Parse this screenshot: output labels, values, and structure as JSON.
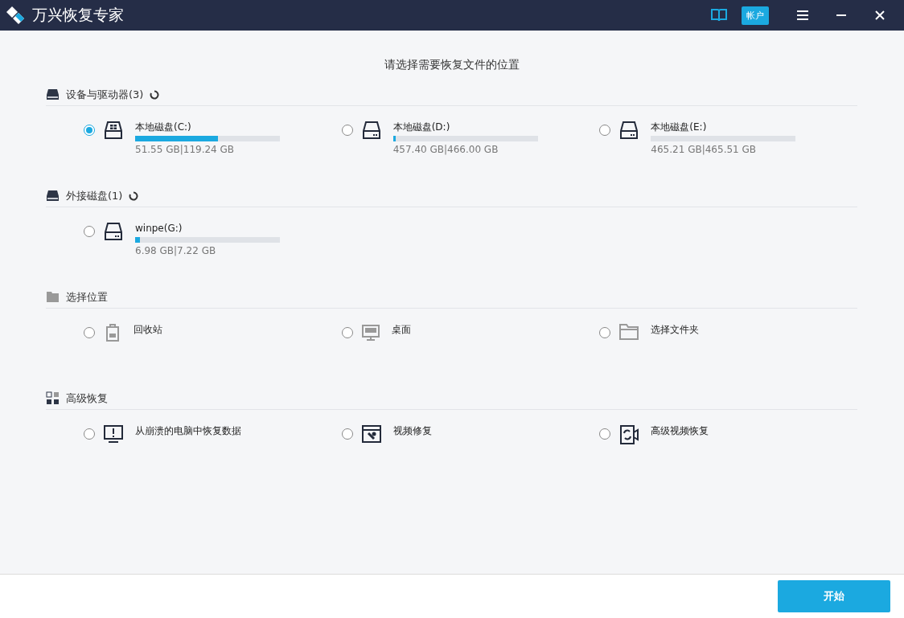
{
  "window": {
    "title": "万兴恢复专家",
    "account_button": "帐户"
  },
  "heading": "请选择需要恢复文件的位置",
  "sections": [
    {
      "kind": "drives",
      "title": "设备与驱动器(3)",
      "loading": true,
      "items": [
        {
          "kind": "system",
          "label": "本地磁盘(C:)",
          "selected": true,
          "level": 0.57,
          "reading": "51.55 GB|119.24 GB"
        },
        {
          "kind": "drive",
          "label": "本地磁盘(D:)",
          "selected": false,
          "level": 0.02,
          "reading": "457.40 GB|466.00 GB"
        },
        {
          "kind": "drive",
          "label": "本地磁盘(E:)",
          "selected": false,
          "level": 0,
          "reading": "465.21 GB|465.51 GB"
        }
      ]
    },
    {
      "kind": "drives",
      "title": "外接磁盘(1)",
      "loading": true,
      "items": [
        {
          "kind": "drive",
          "label": "winpe(G:)",
          "selected": false,
          "level": 0.035,
          "reading": "6.98 GB|7.22 GB"
        }
      ]
    },
    {
      "kind": "location",
      "title": "选择位置",
      "loading": false,
      "items": [
        {
          "kind": "trash",
          "label": "回收站",
          "selected": false
        },
        {
          "kind": "desktop",
          "label": "桌面",
          "selected": false
        },
        {
          "kind": "folder",
          "label": "选择文件夹",
          "selected": false
        }
      ]
    },
    {
      "kind": "advanced",
      "title": "高级恢复",
      "loading": false,
      "items": [
        {
          "kind": "crash",
          "label": "从崩溃的电脑中恢复数据",
          "selected": false
        },
        {
          "kind": "video",
          "label": "视频修复",
          "selected": false
        },
        {
          "kind": "camera",
          "label": "高级视频恢复",
          "selected": false
        }
      ]
    }
  ],
  "start_button": "开始"
}
